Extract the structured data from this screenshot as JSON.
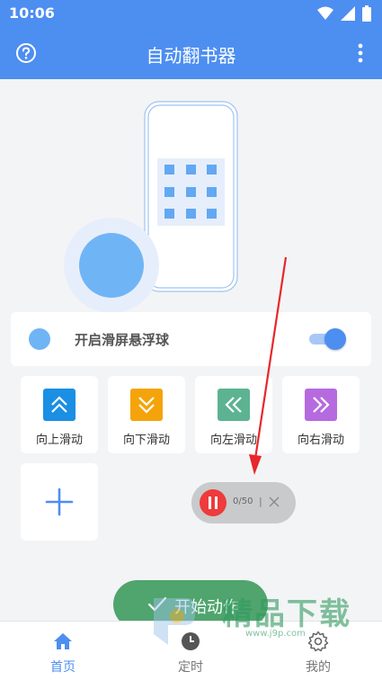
{
  "status_bar": {
    "time": "10:06",
    "icons": [
      "wifi-icon",
      "signal-icon",
      "battery-icon"
    ]
  },
  "app_bar": {
    "title": "自动翻书器",
    "left_icon": "help-icon",
    "right_icon": "more-vert-icon"
  },
  "floating_ball_setting": {
    "label": "开启滑屏悬浮球",
    "enabled": true
  },
  "actions": [
    {
      "label": "向上滑动",
      "icon": "double-chevron-up-icon",
      "color": "#1a8fe3"
    },
    {
      "label": "向下滑动",
      "icon": "double-chevron-down-icon",
      "color": "#f4a40a"
    },
    {
      "label": "向左滑动",
      "icon": "double-chevron-left-icon",
      "color": "#5cb392"
    },
    {
      "label": "向右滑动",
      "icon": "double-chevron-right-icon",
      "color": "#b66adf"
    }
  ],
  "add_card": {
    "icon": "plus-icon"
  },
  "floating_control": {
    "count": "0/50",
    "separator": "|"
  },
  "start_button": {
    "label": "开始动作"
  },
  "bottom_nav": [
    {
      "label": "首页",
      "icon": "home-icon",
      "active": true
    },
    {
      "label": "定时",
      "icon": "clock-icon",
      "active": false
    },
    {
      "label": "我的",
      "icon": "settings-icon",
      "active": false
    }
  ],
  "watermark": {
    "brand": "精品下载",
    "url": "www.j9p.com"
  },
  "colors": {
    "primary": "#4d8ef1",
    "start_green": "#4fa56d",
    "pause_red": "#ee3b3b",
    "ball_blue": "#6fb5f6",
    "annotation_red": "#e8262b"
  }
}
